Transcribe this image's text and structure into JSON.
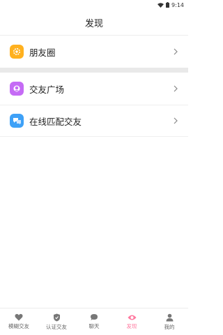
{
  "status": {
    "time": "9:14"
  },
  "header": {
    "title": "发现"
  },
  "menu": {
    "group1": [
      {
        "label": "朋友圈",
        "icon": "gear-icon"
      }
    ],
    "group2": [
      {
        "label": "交友广场",
        "icon": "globe-icon"
      },
      {
        "label": "在线匹配交友",
        "icon": "chat-match-icon"
      }
    ]
  },
  "tabs": [
    {
      "label": "模糊交友",
      "icon": "heart-icon"
    },
    {
      "label": "认证交友",
      "icon": "shield-icon"
    },
    {
      "label": "聊天",
      "icon": "chat-icon"
    },
    {
      "label": "发现",
      "icon": "eye-icon",
      "active": true
    },
    {
      "label": "我的",
      "icon": "user-icon"
    }
  ],
  "colors": {
    "accent": "#ff7aa0",
    "orange": "#ffb11f",
    "purple": "#c56bf5",
    "blue": "#3ea1f7"
  }
}
